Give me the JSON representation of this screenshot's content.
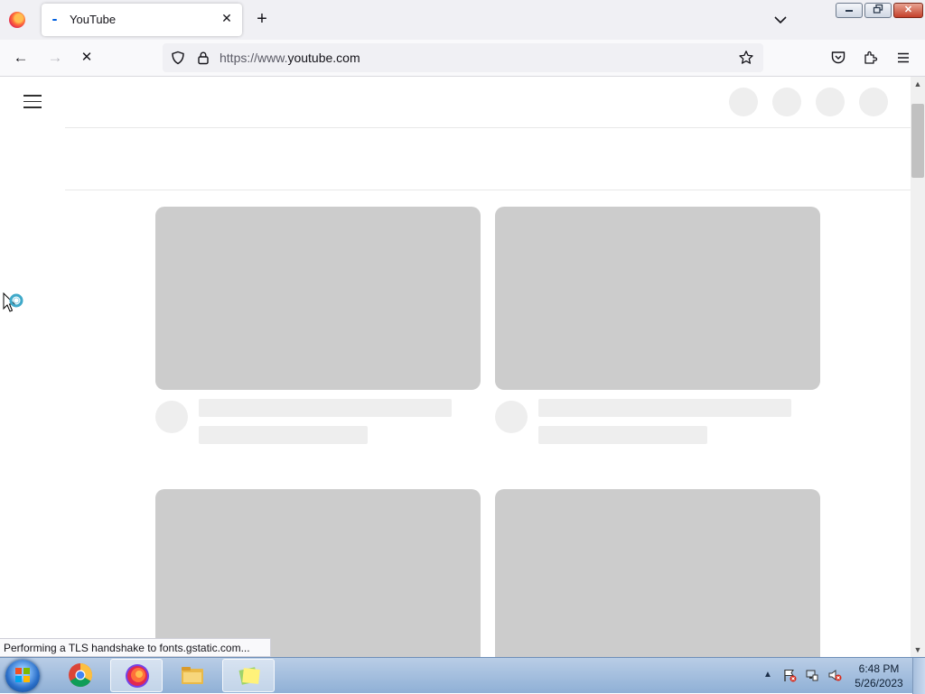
{
  "browser": {
    "tab_title": "YouTube",
    "url_prefix": "https://www.",
    "url_host": "youtube.com",
    "status_text": "Performing a TLS handshake to fonts.gstatic.com..."
  },
  "icons": {
    "back": "←",
    "forward": "→",
    "stop": "✕",
    "tab_close": "✕",
    "new_tab": "+",
    "min": "▭",
    "max": "❐",
    "close": "✕",
    "scroll_up": "▲",
    "scroll_down": "▼",
    "tray_arrow": "▲"
  },
  "taskbar": {
    "time": "6:48 PM",
    "date": "5/26/2023"
  },
  "colors": {
    "skeleton_thumb": "#cccccc",
    "skeleton_line": "#eeeeee",
    "firefox_accent": "#0060df"
  }
}
